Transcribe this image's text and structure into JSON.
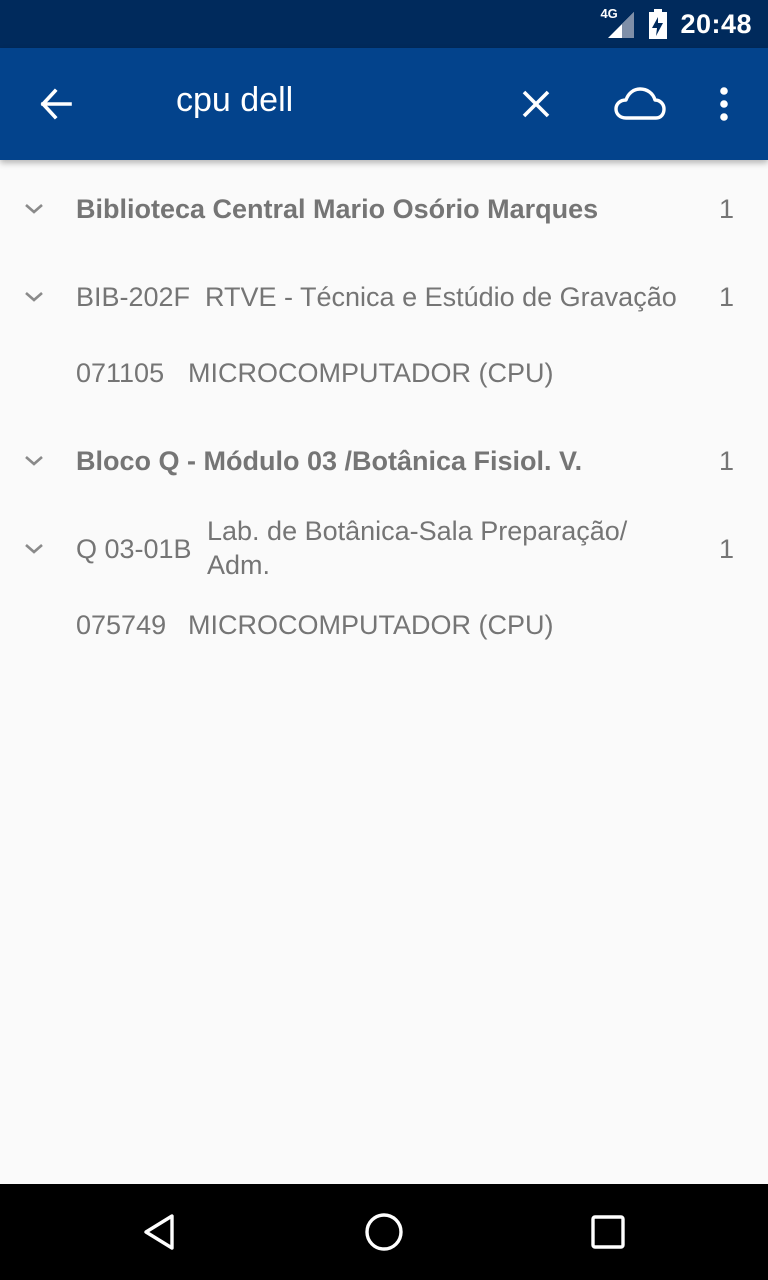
{
  "status_bar": {
    "network": "4G",
    "time": "20:48"
  },
  "app_bar": {
    "back_icon": "arrow-back-icon",
    "search_query": "cpu dell",
    "clear_icon": "close-icon",
    "cloud_icon": "cloud-icon",
    "menu_icon": "more-vert-icon"
  },
  "results": {
    "groups": [
      {
        "title": "Biblioteca Central Mario Osório Marques",
        "count": "1",
        "rooms": [
          {
            "code": "BIB-202F",
            "name": "RTVE - Técnica e Estúdio de Gravação",
            "count": "1",
            "items": [
              {
                "id": "071105",
                "description": "MICROCOMPUTADOR (CPU)"
              }
            ]
          }
        ]
      },
      {
        "title": "Bloco Q - Módulo 03 /Botânica Fisiol. V.",
        "count": "1",
        "rooms": [
          {
            "code": "Q 03-01B",
            "name_line1": "Lab. de Botânica-Sala Preparação/",
            "name_line2": "Adm.",
            "count": "1",
            "items": [
              {
                "id": "075749",
                "description": "MICROCOMPUTADOR (CPU)"
              }
            ]
          }
        ]
      }
    ]
  },
  "nav_bar": {
    "back": "triangle-back-icon",
    "home": "circle-home-icon",
    "recents": "square-recents-icon"
  },
  "colors": {
    "status_bar": "#002a5c",
    "app_bar": "#03438c",
    "background": "#fafafa",
    "text_secondary": "#757575"
  }
}
